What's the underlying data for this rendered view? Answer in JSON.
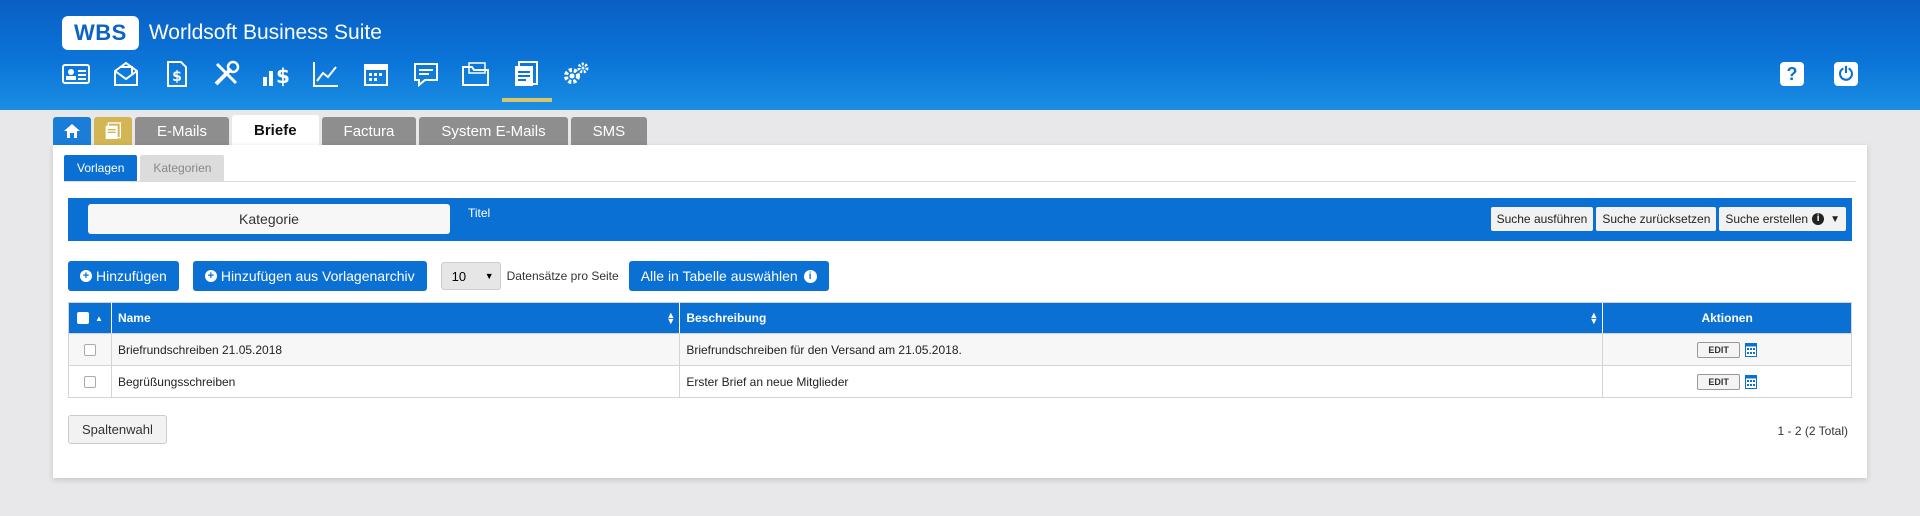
{
  "app": {
    "logo": "WBS",
    "title": "Worldsoft Business Suite"
  },
  "toolbar": {
    "icons": [
      "contact-card-icon",
      "mail-icon",
      "invoice-icon",
      "tools-icon",
      "sales-icon",
      "chart-icon",
      "calendar-icon",
      "chat-icon",
      "folder-icon",
      "letters-icon",
      "settings-icon"
    ],
    "active": "letters-icon"
  },
  "top_right": {
    "help": "?",
    "power": "⏻"
  },
  "main_tabs": [
    "E-Mails",
    "Briefe",
    "Factura",
    "System E-Mails",
    "SMS"
  ],
  "active_tab": "Briefe",
  "sub_tabs": [
    "Vorlagen",
    "Kategorien"
  ],
  "filter": {
    "kategorie": "Kategorie",
    "titel": "Titel",
    "search_run": "Suche ausführen",
    "search_reset": "Suche zurücksetzen",
    "search_create": "Suche erstellen"
  },
  "actions": {
    "add": "Hinzufügen",
    "add_from_archive": "Hinzufügen aus Vorlagenarchiv",
    "page_size": "10",
    "per_page_label": "Datensätze pro Seite",
    "select_all": "Alle in Tabelle auswählen"
  },
  "table": {
    "headers": [
      "Name",
      "Beschreibung",
      "Aktionen"
    ],
    "rows": [
      {
        "name": "Briefrundschreiben 21.05.2018",
        "description": "Briefrundschreiben für den Versand am 21.05.2018.",
        "action": "EDIT"
      },
      {
        "name": "Begrüßungsschreiben",
        "description": "Erster Brief an neue Mitglieder",
        "action": "EDIT"
      }
    ]
  },
  "footer": {
    "columns_button": "Spaltenwahl",
    "pager": "1 - 2 (2 Total)"
  },
  "colors": {
    "primary": "#0b70d4",
    "tab_grey": "#8e8e8e",
    "accent": "#d8c46a"
  }
}
